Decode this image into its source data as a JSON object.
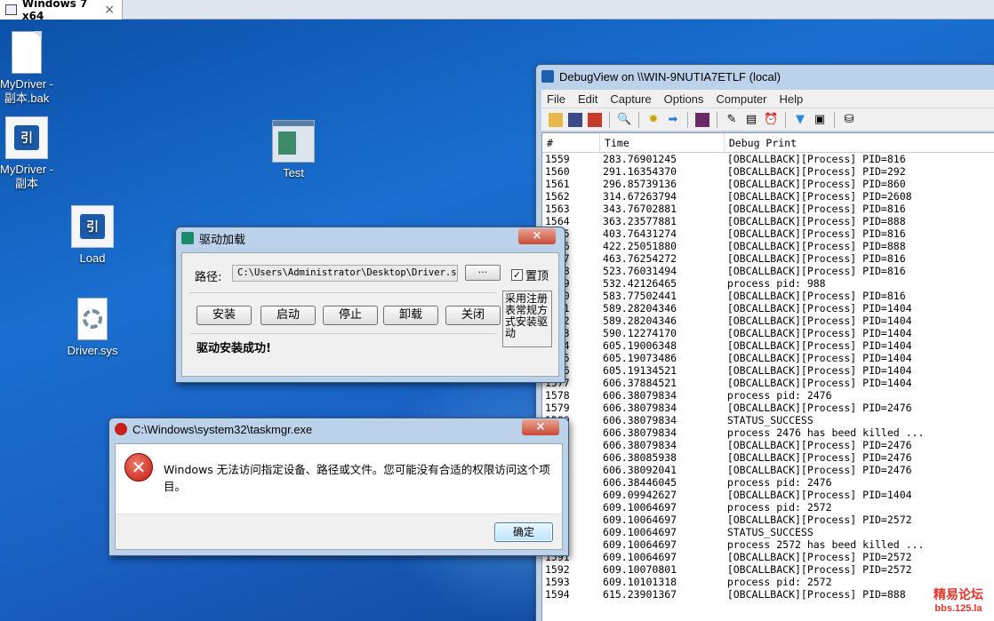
{
  "vm_tab": {
    "title": "Windows 7 x64",
    "close_glyph": "×"
  },
  "desktop_icons": [
    {
      "label": "MyDriver -\n副本.bak",
      "icon": "file-icon"
    },
    {
      "label": "MyDriver -\n副本",
      "icon": "app-icon"
    },
    {
      "label": "Test",
      "icon": "window-app-icon"
    },
    {
      "label": "Load",
      "icon": "app-icon"
    },
    {
      "label": "Driver.sys",
      "icon": "system-file-icon"
    }
  ],
  "debugview": {
    "title": "DebugView on \\\\WIN-9NUTIA7ETLF (local)",
    "menu": [
      "File",
      "Edit",
      "Capture",
      "Options",
      "Computer",
      "Help"
    ],
    "columns": [
      "#",
      "Time",
      "Debug Print"
    ],
    "rows": [
      [
        "1559",
        "283.76901245",
        "[OBCALLBACK][Process] PID=816"
      ],
      [
        "1560",
        "291.16354370",
        "[OBCALLBACK][Process] PID=292"
      ],
      [
        "1561",
        "296.85739136",
        "[OBCALLBACK][Process] PID=860"
      ],
      [
        "1562",
        "314.67263794",
        "[OBCALLBACK][Process] PID=2608"
      ],
      [
        "1563",
        "343.76702881",
        "[OBCALLBACK][Process] PID=816"
      ],
      [
        "1564",
        "363.23577881",
        "[OBCALLBACK][Process] PID=888"
      ],
      [
        "1565",
        "403.76431274",
        "[OBCALLBACK][Process] PID=816"
      ],
      [
        "1566",
        "422.25051880",
        "[OBCALLBACK][Process] PID=888"
      ],
      [
        "1567",
        "463.76254272",
        "[OBCALLBACK][Process] PID=816"
      ],
      [
        "1568",
        "523.76031494",
        "[OBCALLBACK][Process] PID=816"
      ],
      [
        "1569",
        "532.42126465",
        "process pid: 988"
      ],
      [
        "1570",
        "583.77502441",
        "[OBCALLBACK][Process] PID=816"
      ],
      [
        "1571",
        "589.28204346",
        "[OBCALLBACK][Process] PID=1404"
      ],
      [
        "1572",
        "589.28204346",
        "[OBCALLBACK][Process] PID=1404"
      ],
      [
        "1573",
        "590.12274170",
        "[OBCALLBACK][Process] PID=1404"
      ],
      [
        "1574",
        "605.19006348",
        "[OBCALLBACK][Process] PID=1404"
      ],
      [
        "1575",
        "605.19073486",
        "[OBCALLBACK][Process] PID=1404"
      ],
      [
        "1576",
        "605.19134521",
        "[OBCALLBACK][Process] PID=1404"
      ],
      [
        "1577",
        "606.37884521",
        "[OBCALLBACK][Process] PID=1404"
      ],
      [
        "1578",
        "606.38079834",
        "process pid: 2476"
      ],
      [
        "1579",
        "606.38079834",
        "[OBCALLBACK][Process] PID=2476"
      ],
      [
        "1580",
        "606.38079834",
        "STATUS_SUCCESS"
      ],
      [
        "1581",
        "606.38079834",
        "process 2476 has beed killed ..."
      ],
      [
        "1582",
        "606.38079834",
        "[OBCALLBACK][Process] PID=2476"
      ],
      [
        "1583",
        "606.38085938",
        "[OBCALLBACK][Process] PID=2476"
      ],
      [
        "1584",
        "606.38092041",
        "[OBCALLBACK][Process] PID=2476"
      ],
      [
        "1585",
        "606.38446045",
        "process pid: 2476"
      ],
      [
        "1586",
        "609.09942627",
        "[OBCALLBACK][Process] PID=1404"
      ],
      [
        "1587",
        "609.10064697",
        "process pid: 2572"
      ],
      [
        "1588",
        "609.10064697",
        "[OBCALLBACK][Process] PID=2572"
      ],
      [
        "1589",
        "609.10064697",
        "STATUS_SUCCESS"
      ],
      [
        "1590",
        "609.10064697",
        "process 2572 has beed killed ..."
      ],
      [
        "1591",
        "609.10064697",
        "[OBCALLBACK][Process] PID=2572"
      ],
      [
        "1592",
        "609.10070801",
        "[OBCALLBACK][Process] PID=2572"
      ],
      [
        "1593",
        "609.10101318",
        "process pid: 2572"
      ],
      [
        "1594",
        "615.23901367",
        "[OBCALLBACK][Process] PID=888"
      ]
    ]
  },
  "loader": {
    "title": "驱动加载",
    "path_label": "路径:",
    "path_value": "C:\\Users\\Administrator\\Desktop\\Driver.sys",
    "browse_label": "···",
    "topmost_label": "置顶",
    "topmost_checked": true,
    "buttons": [
      "安装",
      "启动",
      "停止",
      "卸载",
      "关闭"
    ],
    "status": "驱动安装成功!",
    "side_note": "采用注册表常规方式安装驱动",
    "close_glyph": "×"
  },
  "error_dialog": {
    "title": "C:\\Windows\\system32\\taskmgr.exe",
    "message": "Windows 无法访问指定设备、路径或文件。您可能没有合适的权限访问这个项目。",
    "ok_label": "确定",
    "close_glyph": "×"
  },
  "watermark": {
    "line1": "精易论坛",
    "line2": "bbs.125.la"
  }
}
